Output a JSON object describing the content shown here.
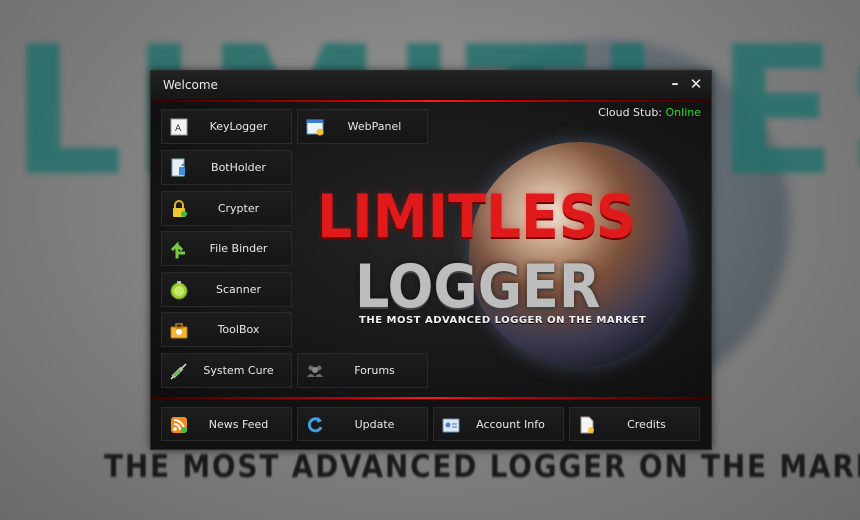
{
  "background": {
    "big_title": "LIMITLESS",
    "tagline": "THE MOST ADVANCED LOGGER ON THE MARKET"
  },
  "window": {
    "title": "Welcome",
    "minimize_glyph": "–",
    "close_glyph": "✕"
  },
  "status": {
    "label": "Cloud Stub:",
    "value": "Online",
    "value_color": "#2fd72f"
  },
  "logo": {
    "line1": "LIMITLESS",
    "line2": "LOGGER",
    "tagline": "THE MOST ADVANCED LOGGER ON THE MARKET"
  },
  "menu": {
    "keylogger": "KeyLogger",
    "webpanel": "WebPanel",
    "botholder": "BotHolder",
    "crypter": "Crypter",
    "file_binder": "File Binder",
    "scanner": "Scanner",
    "toolbox": "ToolBox",
    "system_cure": "System Cure",
    "forums": "Forums"
  },
  "footer": {
    "news_feed": "News Feed",
    "update": "Update",
    "account_info": "Account Info",
    "credits": "Credits"
  },
  "colors": {
    "accent_red": "#e01a1a",
    "online_green": "#2fd72f"
  }
}
